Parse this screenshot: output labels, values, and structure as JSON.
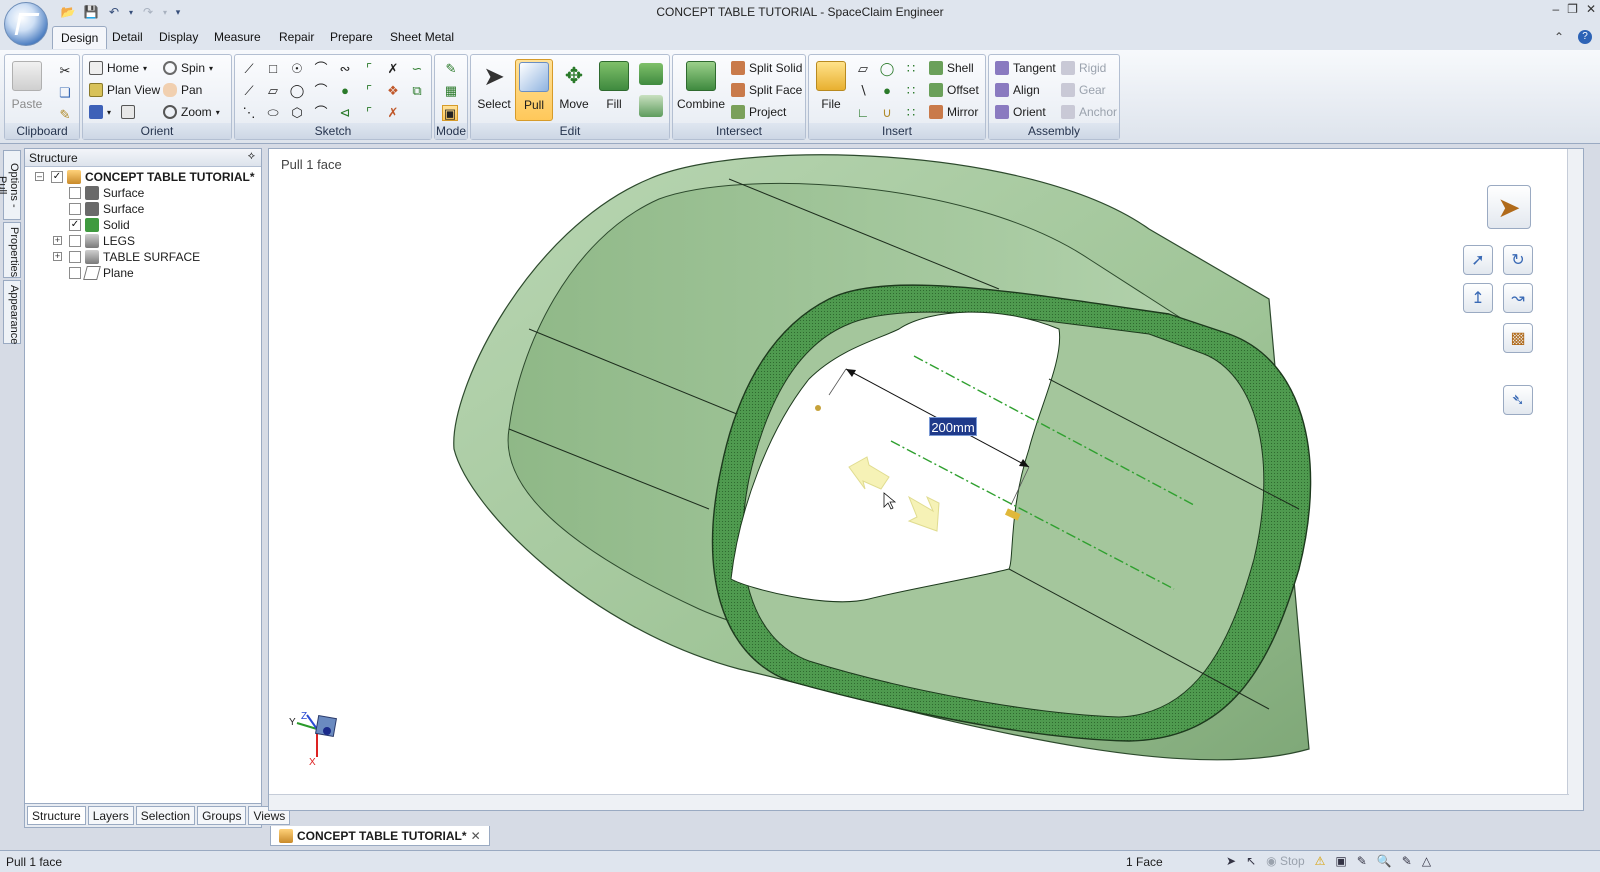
{
  "app": {
    "title": "CONCEPT TABLE TUTORIAL - SpaceClaim Engineer"
  },
  "tabs": [
    "Design",
    "Detail",
    "Display",
    "Measure",
    "Repair",
    "Prepare",
    "Sheet Metal"
  ],
  "ribbon": {
    "clipboard": {
      "label": "Clipboard",
      "paste": "Paste"
    },
    "orient": {
      "label": "Orient",
      "home": "Home",
      "spin": "Spin",
      "plan_view": "Plan View",
      "pan": "Pan",
      "zoom": "Zoom"
    },
    "sketch": {
      "label": "Sketch"
    },
    "mode": {
      "label": "Mode"
    },
    "edit": {
      "label": "Edit",
      "select": "Select",
      "pull": "Pull",
      "move": "Move",
      "fill": "Fill"
    },
    "intersect": {
      "label": "Intersect",
      "combine": "Combine",
      "split_solid": "Split Solid",
      "split_face": "Split Face",
      "project": "Project"
    },
    "insert": {
      "label": "Insert",
      "file": "File",
      "shell": "Shell",
      "offset": "Offset",
      "mirror": "Mirror"
    },
    "assembly": {
      "label": "Assembly",
      "tangent": "Tangent",
      "align": "Align",
      "orient": "Orient",
      "rigid": "Rigid",
      "gear": "Gear",
      "anchor": "Anchor"
    }
  },
  "side_tabs": [
    "Options - Pull",
    "Properties",
    "Appearance"
  ],
  "structure": {
    "header": "Structure",
    "root": "CONCEPT TABLE TUTORIAL*",
    "items": [
      {
        "label": "Surface",
        "checked": false
      },
      {
        "label": "Surface",
        "checked": false
      },
      {
        "label": "Solid",
        "checked": true
      },
      {
        "label": "LEGS",
        "checked": false
      },
      {
        "label": "TABLE SURFACE",
        "checked": false
      },
      {
        "label": "Plane",
        "checked": false
      }
    ],
    "bottom_tabs": [
      "Structure",
      "Layers",
      "Selection",
      "Groups",
      "Views"
    ]
  },
  "viewport": {
    "status": "Pull 1 face",
    "dimension": "200mm",
    "axis_labels": {
      "x": "X",
      "y": "Y",
      "z": "Z"
    }
  },
  "document_tab": "CONCEPT TABLE TUTORIAL*",
  "statusbar": {
    "left": "Pull 1 face",
    "selection": "1 Face",
    "stop": "Stop"
  },
  "colors": {
    "model_green": "#a8c9a3",
    "edge_green": "#3f7a3f",
    "accent_blue": "#1f3a8a"
  }
}
